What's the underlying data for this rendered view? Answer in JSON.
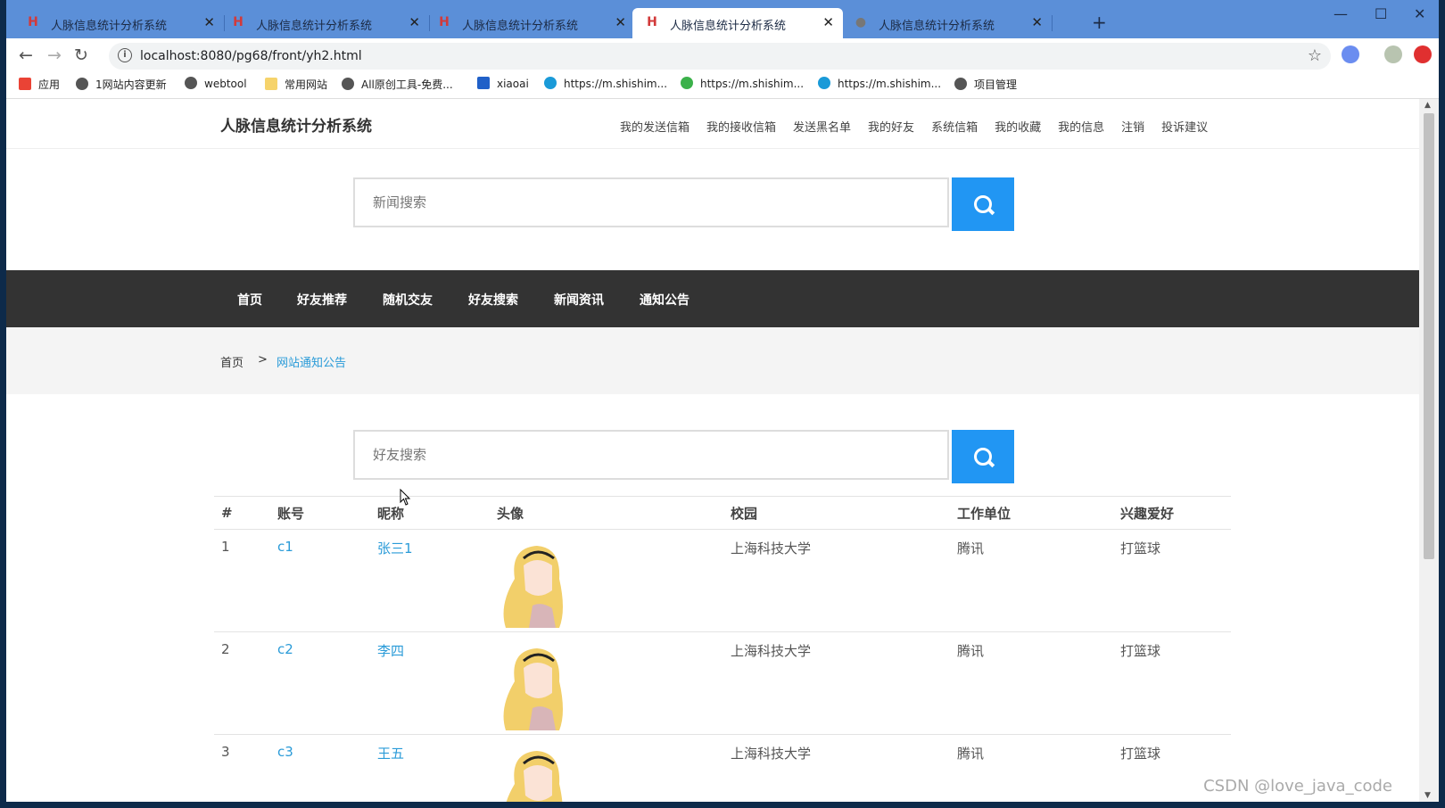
{
  "browser": {
    "tabs": [
      {
        "title": "人脉信息统计分析系统",
        "active": false
      },
      {
        "title": "人脉信息统计分析系统",
        "active": false
      },
      {
        "title": "人脉信息统计分析系统",
        "active": false
      },
      {
        "title": "人脉信息统计分析系统",
        "active": true
      },
      {
        "title": "人脉信息统计分析系统",
        "active": false
      }
    ],
    "url": "localhost:8080/pg68/front/yh2.html",
    "bookmarks": [
      "应用",
      "1网站内容更新",
      "webtool",
      "常用网站",
      "All原创工具-免费...",
      "xiaoai",
      "https://m.shishim...",
      "https://m.shishim...",
      "https://m.shishim...",
      "项目管理"
    ]
  },
  "site": {
    "logo": "人脉信息统计分析系统",
    "top_menu": [
      "我的发送信箱",
      "我的接收信箱",
      "发送黑名单",
      "我的好友",
      "系统信箱",
      "我的收藏",
      "我的信息",
      "注销",
      "投诉建议"
    ],
    "news_search_placeholder": "新闻搜索",
    "main_nav": [
      "首页",
      "好友推荐",
      "随机交友",
      "好友搜索",
      "新闻资讯",
      "通知公告"
    ],
    "breadcrumb": {
      "home": "首页",
      "separator": ">",
      "current": "网站通知公告"
    },
    "friend_search_placeholder": "好友搜索"
  },
  "table": {
    "headers": [
      "#",
      "账号",
      "昵称",
      "头像",
      "校园",
      "工作单位",
      "兴趣爱好"
    ],
    "rows": [
      {
        "num": "1",
        "account": "c1",
        "nickname": "张三1",
        "campus": "上海科技大学",
        "work": "腾讯",
        "hobby": "打篮球"
      },
      {
        "num": "2",
        "account": "c2",
        "nickname": "李四",
        "campus": "上海科技大学",
        "work": "腾讯",
        "hobby": "打篮球"
      },
      {
        "num": "3",
        "account": "c3",
        "nickname": "王五",
        "campus": "上海科技大学",
        "work": "腾讯",
        "hobby": "打篮球"
      }
    ]
  },
  "watermark": "CSDN @love_java_code",
  "colors": {
    "accent": "#2196f3",
    "nav_bg": "#333333",
    "link": "#2a9bd8",
    "tabstrip": "#5b8fd8"
  }
}
